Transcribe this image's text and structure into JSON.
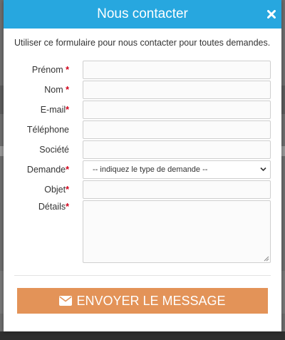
{
  "modal": {
    "title": "Nous contacter",
    "intro": "Utiliser ce formulaire pour nous contacter pour toutes demandes."
  },
  "form": {
    "fields": [
      {
        "label": "Prénom",
        "required": "*",
        "value": ""
      },
      {
        "label": "Nom",
        "required": "*",
        "value": ""
      },
      {
        "label": "E-mail",
        "required": "*",
        "value": ""
      },
      {
        "label": "Téléphone",
        "required": "",
        "value": ""
      },
      {
        "label": "Société",
        "required": "",
        "value": ""
      },
      {
        "label": "Demande",
        "required": "*",
        "value": "-- indiquez le type de demande --"
      },
      {
        "label": "Objet",
        "required": "*",
        "value": ""
      },
      {
        "label": "Détails",
        "required": "*",
        "value": ""
      }
    ],
    "submit_label": "ENVOYER LE MESSAGE"
  },
  "icons": {
    "close": "close-icon",
    "submit": "envelope-icon",
    "select": "chevron-down-icon",
    "resize": "resize-handle-icon"
  },
  "colors": {
    "header": "#27a7df",
    "submit": "#e39358",
    "required": "#d0021b"
  }
}
